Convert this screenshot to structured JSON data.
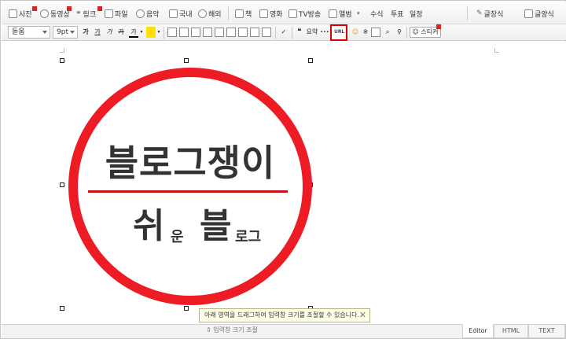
{
  "toolbar1": {
    "items": [
      "사진",
      "동영상",
      "링크",
      "파일",
      "음악",
      "국내",
      "해외",
      "책",
      "영화",
      "TV방송",
      "앨범",
      "수식",
      "투표",
      "일정",
      "글장식",
      "글양식"
    ]
  },
  "toolbar2": {
    "font": "돋움",
    "size": "9pt",
    "fmt": [
      "가",
      "가",
      "가",
      "가",
      "가"
    ],
    "quote": "❝",
    "emoticon_label": "요약",
    "url_label": "URL",
    "sticker": "스티커"
  },
  "content": {
    "title": "블로그쟁이",
    "sub1_big": "쉬",
    "sub1_small": "운",
    "sub2_big": "블",
    "sub2_small": "로그",
    "ring_color": "#ed1b24",
    "line_color": "#c8101a"
  },
  "tip": {
    "text": "아래 영역을 드래그하여 입력창 크기를 조절할 수 있습니다."
  },
  "bottom": {
    "resize": "⇕ 입력창 크기 조절",
    "tabs": [
      "Editor",
      "HTML",
      "TEXT"
    ]
  }
}
